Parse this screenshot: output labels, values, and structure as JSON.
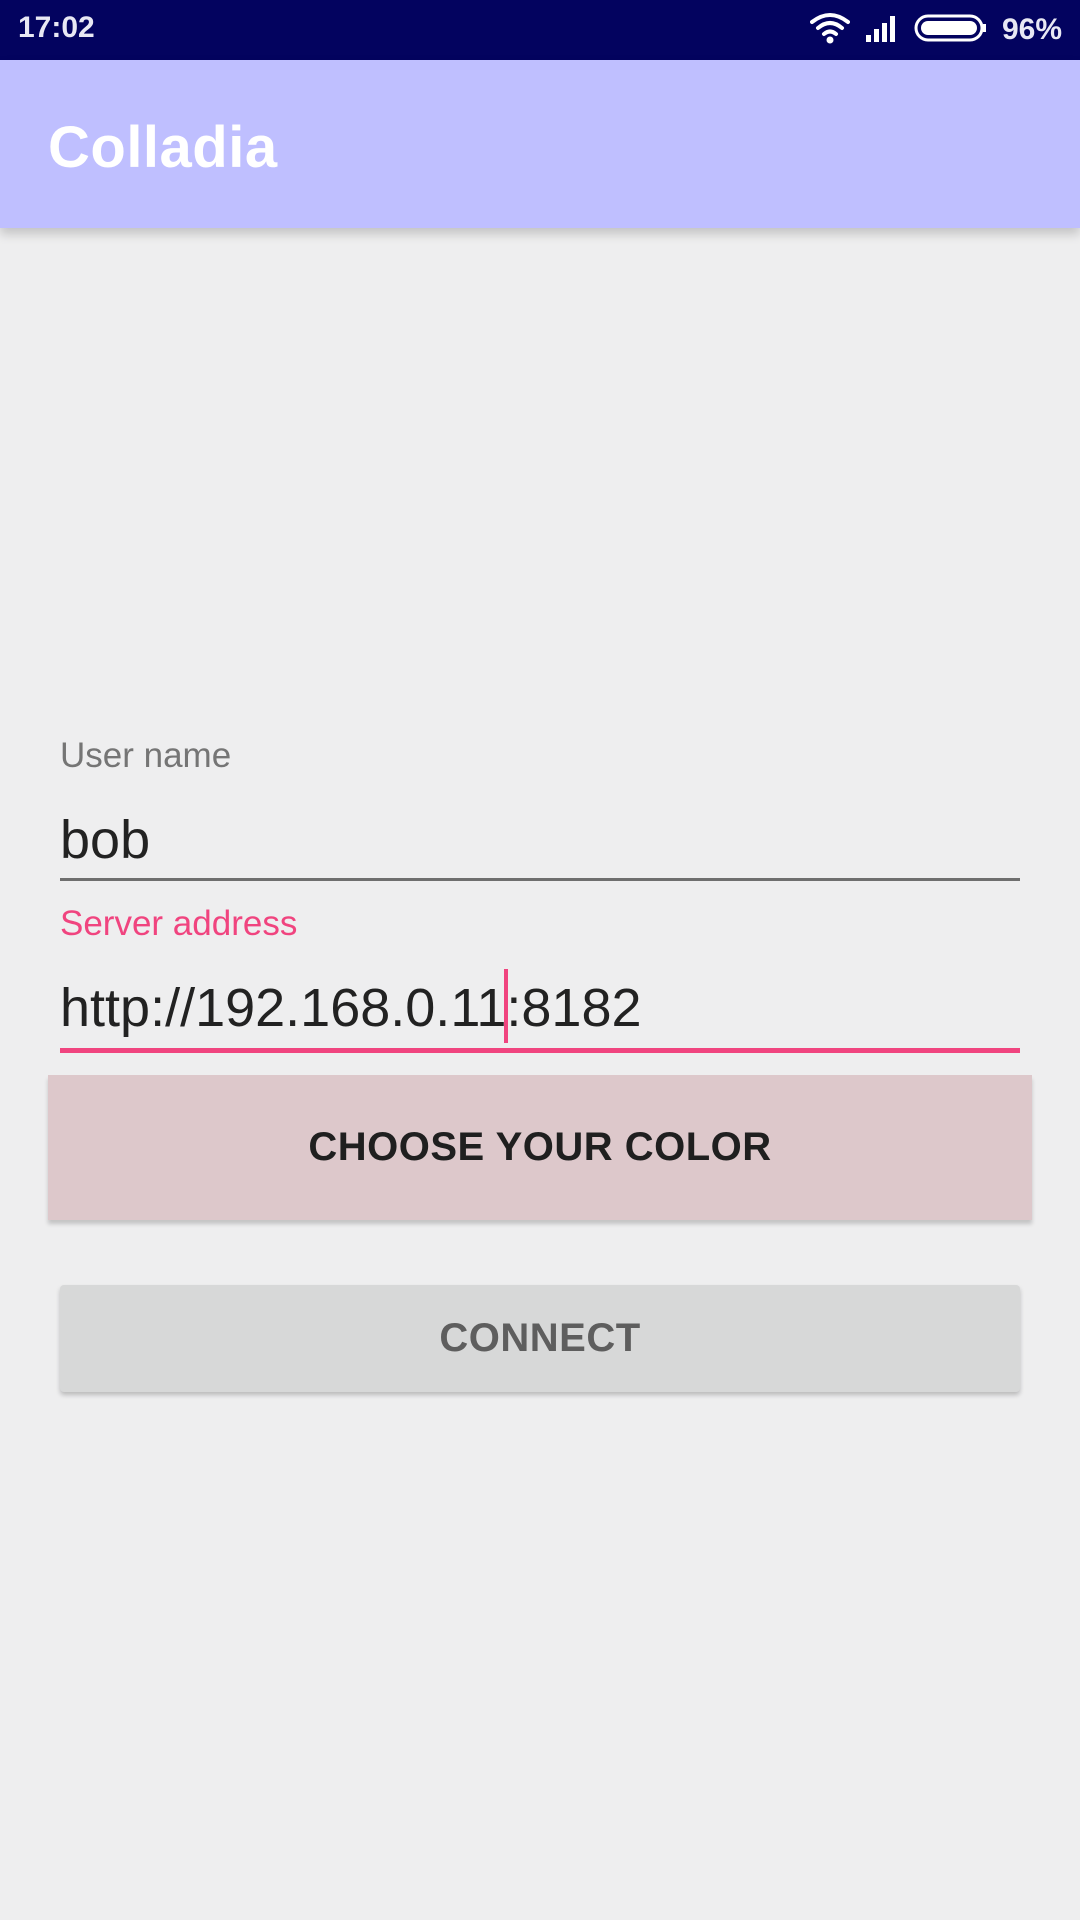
{
  "status_bar": {
    "time": "17:02",
    "battery_percent": "96%",
    "battery_level": 0.96,
    "icons": [
      "wifi-icon",
      "signal-icon",
      "battery-icon"
    ]
  },
  "app_bar": {
    "title": "Colladia"
  },
  "form": {
    "username": {
      "label": "User name",
      "value": "bob"
    },
    "server": {
      "label": "Server address",
      "value_before_caret": "http://192.168.0.11",
      "value_after_caret": ":8182"
    }
  },
  "buttons": {
    "choose_color": "CHOOSE YOUR COLOR",
    "connect": "CONNECT"
  },
  "colors": {
    "status_bar": "#03035f",
    "app_bar": "#bfbfff",
    "accent": "#f0447f",
    "background": "#eeeeef",
    "color_button": "#ddc8cb",
    "connect_button": "#d7d8d8"
  }
}
